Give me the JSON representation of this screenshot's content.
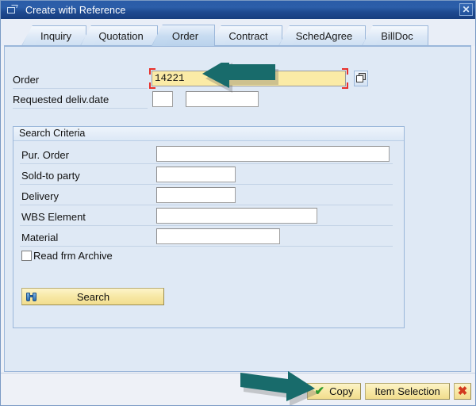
{
  "window": {
    "title": "Create with Reference",
    "icon": "window-restore-icon",
    "close_label": "✕"
  },
  "tabs": [
    {
      "label": "Inquiry",
      "active": false
    },
    {
      "label": "Quotation",
      "active": false
    },
    {
      "label": "Order",
      "active": true
    },
    {
      "label": "Contract",
      "active": false
    },
    {
      "label": "SchedAgree",
      "active": false
    },
    {
      "label": "BillDoc",
      "active": false
    }
  ],
  "form": {
    "order": {
      "label": "Order",
      "value": "14221",
      "placeholder": "",
      "focused": true
    },
    "requested_deliv_date": {
      "label": "Requested deliv.date",
      "value_short": "",
      "value_long": "",
      "placeholder": ""
    },
    "multi_select_icon": "multiple-selection-icon"
  },
  "search_criteria": {
    "title": "Search Criteria",
    "fields": [
      {
        "label": "Pur. Order",
        "value": "",
        "placeholder": ""
      },
      {
        "label": "Sold-to party",
        "value": "",
        "placeholder": ""
      },
      {
        "label": "Delivery",
        "value": "",
        "placeholder": ""
      },
      {
        "label": "WBS Element",
        "value": "",
        "placeholder": ""
      },
      {
        "label": "Material",
        "value": "",
        "placeholder": ""
      }
    ],
    "checkbox": {
      "label": "Read frm Archive",
      "checked": false
    },
    "search_button": {
      "label": "Search",
      "icon": "binoculars-icon"
    }
  },
  "footer": {
    "copy_button": {
      "label": "Copy",
      "icon": "green-check-icon"
    },
    "item_selection_button": {
      "label": "Item Selection"
    },
    "cancel_button": {
      "label": "✖",
      "icon": "red-x-icon"
    }
  },
  "annotations": [
    {
      "name": "arrow-to-order-field",
      "direction": "left",
      "color": "#186b6b"
    },
    {
      "name": "arrow-to-copy-button",
      "direction": "right",
      "color": "#186b6b"
    }
  ],
  "colors": {
    "titlebar": "#2a5ca8",
    "content_bg": "#dfe9f5",
    "focused_field": "#fbeba6",
    "button_yellow": "#f7e8a5",
    "focus_marker": "#e8302a",
    "annotation": "#186b6b"
  }
}
